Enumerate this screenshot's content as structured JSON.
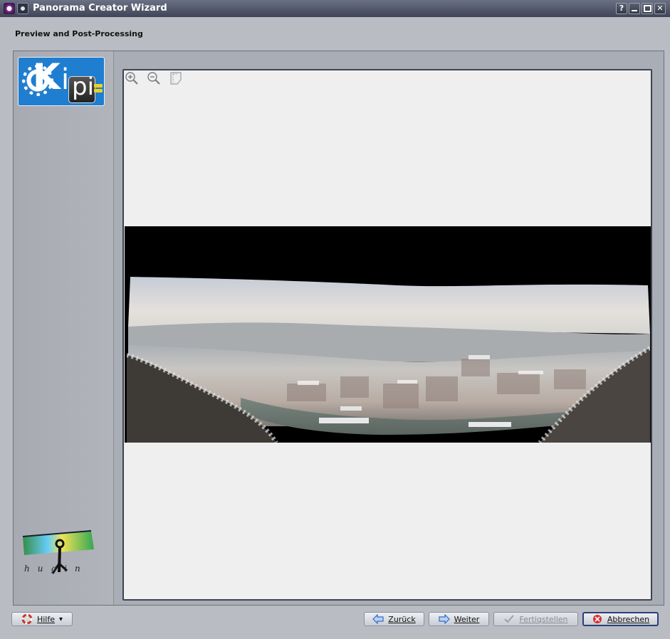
{
  "window": {
    "title": "Panorama Creator Wizard",
    "controls": {
      "help": "?",
      "minimize": "▁",
      "maximize": "□",
      "close": "✕"
    }
  },
  "page": {
    "heading": "Preview and Post-Processing"
  },
  "sidebar": {
    "top_logo": {
      "text_k": "K",
      "text_i": "i",
      "text_pi": "pi"
    },
    "bottom_logo": {
      "text": "hugin"
    }
  },
  "preview": {
    "tools": [
      "zoom-in-icon",
      "zoom-out-icon",
      "fit-to-window-icon"
    ]
  },
  "buttons": {
    "help": "Hilfe",
    "back": "Zurück",
    "next": "Weiter",
    "finish": "Fertigstellen",
    "cancel": "Abbrechen"
  },
  "colors": {
    "titlebar": "#3f4556",
    "kipi_blue": "#1f7ed0",
    "preview_bg": "#efefef",
    "cancel_icon": "#d83030",
    "arrow_blue": "#2f6cc8"
  }
}
